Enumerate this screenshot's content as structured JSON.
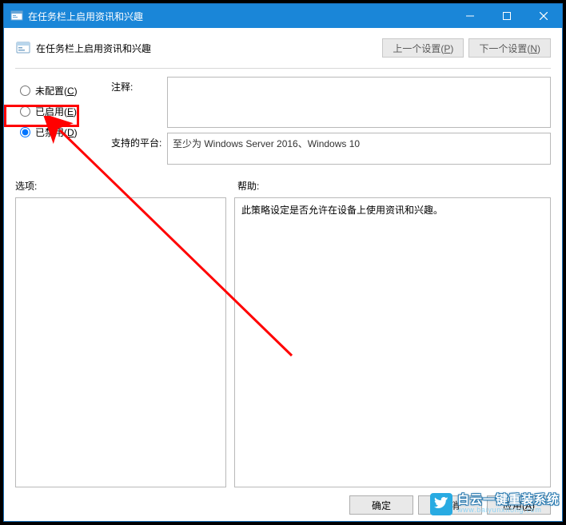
{
  "titlebar": {
    "title": "在任务栏上启用资讯和兴趣"
  },
  "header": {
    "title": "在任务栏上启用资讯和兴趣",
    "prev": "上一个设置(P)",
    "next": "下一个设置(N)"
  },
  "radios": {
    "not_configured": "未配置(C)",
    "enabled": "已启用(E)",
    "disabled": "已禁用(D)",
    "selected": "disabled"
  },
  "fields": {
    "comment_label": "注释:",
    "comment_value": "",
    "platform_label": "支持的平台:",
    "platform_value": "至少为 Windows Server 2016、Windows 10"
  },
  "labels": {
    "options": "选项:",
    "help": "帮助:"
  },
  "help_text": "此策略设定是否允许在设备上使用资讯和兴趣。",
  "buttons": {
    "ok": "确定",
    "cancel": "取消",
    "apply": "应用(A)"
  },
  "watermark": {
    "cn": "白云一键重装系统",
    "en": "www.baiyunxitong.com"
  }
}
